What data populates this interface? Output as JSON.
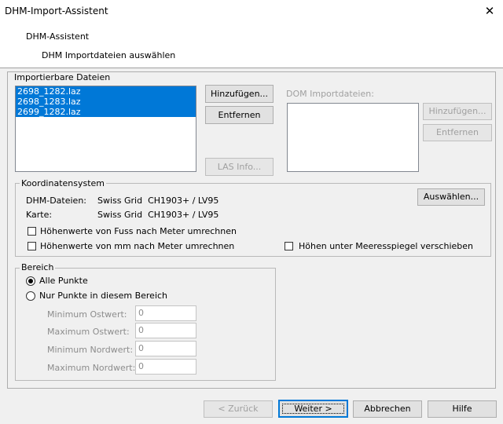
{
  "window": {
    "title": "DHM-Import-Assistent",
    "close_glyph": "✕"
  },
  "header": {
    "title": "DHM-Assistent",
    "subtitle": "DHM Importdateien auswählen"
  },
  "import_files": {
    "legend": "Importierbare Dateien",
    "files": [
      "2698_1282.laz",
      "2698_1283.laz",
      "2699_1282.laz"
    ],
    "add_label": "Hinzufügen...",
    "remove_label": "Entfernen",
    "las_info_label": "LAS Info..."
  },
  "dom_files": {
    "label": "DOM Importdateien:",
    "add_label": "Hinzufügen...",
    "remove_label": "Entfernen"
  },
  "coords": {
    "legend": "Koordinatensystem",
    "dhm_label": "DHM-Dateien:",
    "dhm_value": "Swiss Grid  CH1903+ / LV95",
    "map_label": "Karte:",
    "map_value": "Swiss Grid  CH1903+ / LV95",
    "select_label": "Auswählen...",
    "cb_feet": "Höhenwerte von Fuss nach Meter umrechnen",
    "cb_mm": "Höhenwerte von mm nach Meter umrechnen",
    "cb_sea": "Höhen unter Meeresspiegel verschieben"
  },
  "range": {
    "legend": "Bereich",
    "all_points": "Alle Punkte",
    "only_points": "Nur Punkte in diesem Bereich",
    "min_east_label": "Minimum Ostwert:",
    "min_east_value": "0",
    "max_east_label": "Maximum Ostwert:",
    "max_east_value": "0",
    "min_north_label": "Minimum Nordwert:",
    "min_north_value": "0",
    "max_north_label": "Maximum Nordwert:",
    "max_north_value": "0"
  },
  "footer": {
    "back": "< Zurück",
    "next": "Weiter >",
    "cancel": "Abbrechen",
    "help": "Hilfe"
  }
}
